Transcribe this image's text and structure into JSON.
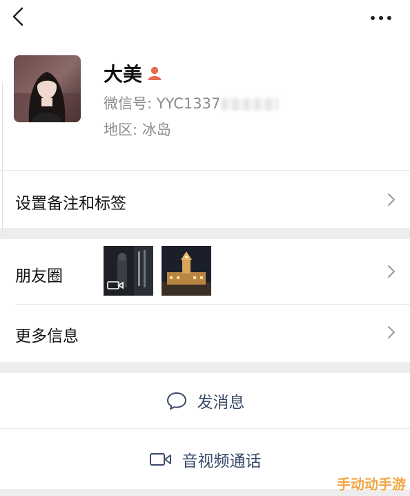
{
  "profile": {
    "name": "大美",
    "wechat_id_label": "微信号: ",
    "wechat_id_value": "YYC1337",
    "region_label": "地区: ",
    "region_value": "冰岛"
  },
  "menu": {
    "remark_tags": "设置备注和标签",
    "moments": "朋友圈",
    "more_info": "更多信息"
  },
  "actions": {
    "send_message": "发消息",
    "av_call": "音视频通话"
  },
  "watermark": "手动动手游",
  "colors": {
    "badge": "#e76b4e",
    "action_text": "#3a4a6b",
    "watermark": "#f2a23a"
  }
}
